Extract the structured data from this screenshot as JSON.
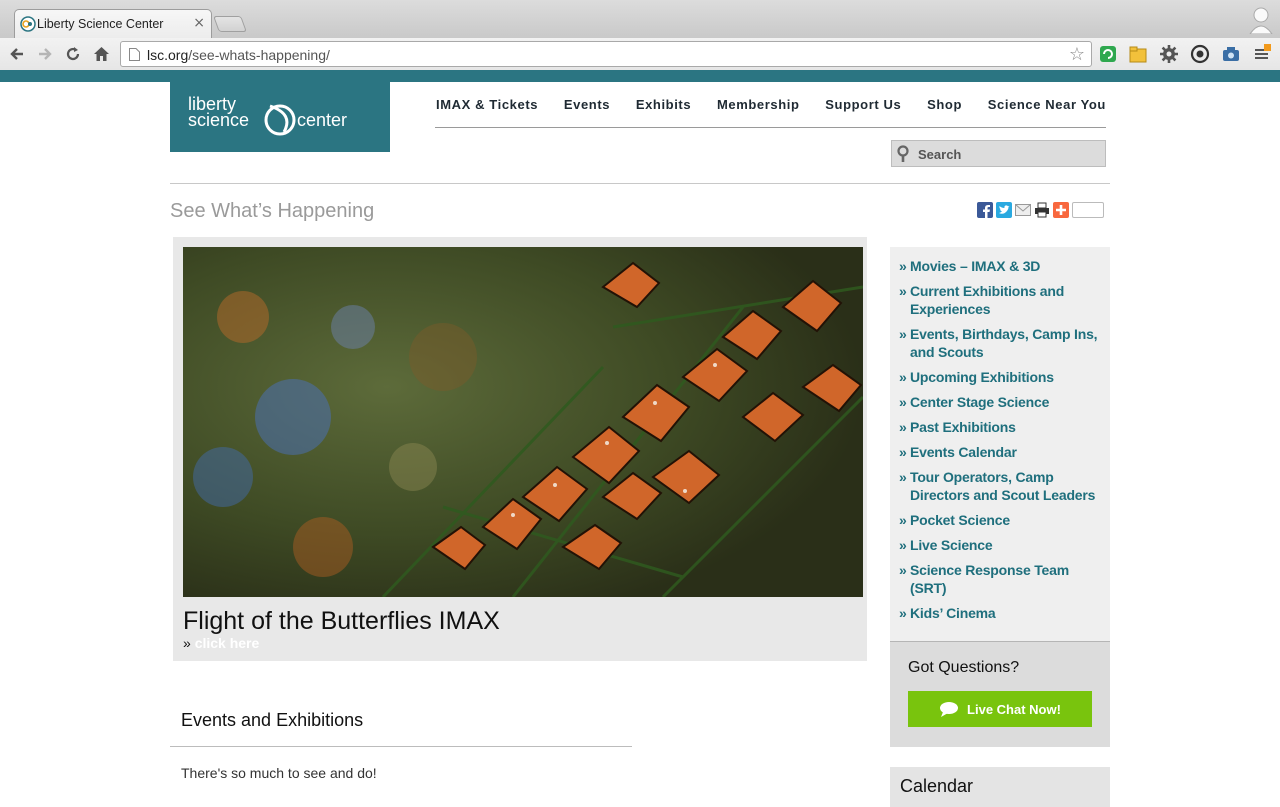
{
  "browser": {
    "tab_title": "Liberty Science Center",
    "url_host": "lsc.org",
    "url_path": "/see-whats-happening/"
  },
  "logo": {
    "line1": "liberty",
    "line2": "science",
    "line3": "center"
  },
  "nav": {
    "items": [
      "IMAX & Tickets",
      "Events",
      "Exhibits",
      "Membership",
      "Support Us",
      "Shop",
      "Science Near You"
    ]
  },
  "search": {
    "placeholder": "Search"
  },
  "page_title": "See What’s Happening",
  "feature": {
    "title": "Flight of the Butterflies IMAX",
    "link_prefix": "»",
    "link_text": "click here"
  },
  "sidebar": {
    "links": [
      "Movies – IMAX & 3D",
      "Current Exhibitions and Experiences",
      "Events, Birthdays, Camp Ins, and Scouts",
      "Upcoming Exhibitions",
      "Center Stage Science",
      "Past Exhibitions",
      "Events Calendar",
      "Tour Operators, Camp Directors and Scout Leaders",
      "Pocket Science",
      "Live Science",
      "Science Response Team (SRT)",
      "Kids’ Cinema"
    ],
    "bullet": "»"
  },
  "questions": {
    "title": "Got Questions?",
    "button": "Live Chat Now!"
  },
  "events": {
    "title": "Events and Exhibitions",
    "text": "There's so much to see and do!"
  },
  "calendar": {
    "title": "Calendar"
  },
  "colors": {
    "brand_teal": "#2b7582",
    "link_teal": "#1f6f7d",
    "chat_green": "#79c40d"
  }
}
